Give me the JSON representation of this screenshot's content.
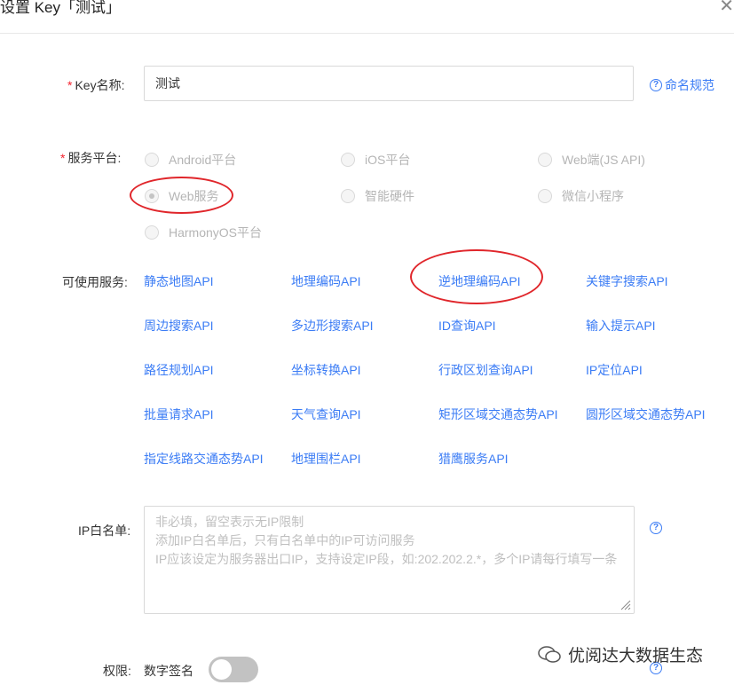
{
  "header": {
    "title": "设置 Key「测试」",
    "close_glyph": "✕"
  },
  "form": {
    "key_name": {
      "required_mark": "*",
      "label": "Key名称:",
      "value": "测试",
      "help_icon": "?",
      "help_text": "命名规范"
    },
    "platform": {
      "required_mark": "*",
      "label": "服务平台:",
      "options": [
        {
          "label": "Android平台",
          "checked": false
        },
        {
          "label": "iOS平台",
          "checked": false
        },
        {
          "label": "Web端(JS API)",
          "checked": false
        },
        {
          "label": "Web服务",
          "checked": true
        },
        {
          "label": "智能硬件",
          "checked": false
        },
        {
          "label": "微信小程序",
          "checked": false
        },
        {
          "label": "HarmonyOS平台",
          "checked": false
        }
      ]
    },
    "services": {
      "label": "可使用服务:",
      "items": [
        "静态地图API",
        "地理编码API",
        "逆地理编码API",
        "关键字搜索API",
        "周边搜索API",
        "多边形搜索API",
        "ID查询API",
        "输入提示API",
        "路径规划API",
        "坐标转换API",
        "行政区划查询API",
        "IP定位API",
        "批量请求API",
        "天气查询API",
        "矩形区域交通态势API",
        "圆形区域交通态势API",
        "指定线路交通态势API",
        "地理围栏API",
        "猎鹰服务API"
      ]
    },
    "ip_whitelist": {
      "label": "IP白名单:",
      "placeholder": "非必填，留空表示无IP限制\n添加IP白名单后，只有白名单中的IP可访问服务\nIP应该设定为服务器出口IP，支持设定IP段，如:202.202.2.*，多个IP请每行填写一条",
      "help_icon": "?"
    },
    "permission": {
      "label": "权限:",
      "option_label": "数字签名",
      "enabled": false,
      "help_icon": "?"
    }
  },
  "watermark": {
    "text": "优阅达大数据生态"
  },
  "colors": {
    "link": "#3b7cf5",
    "required": "#f5222d",
    "annotation": "#e0262b",
    "toggle_off": "#c2c2c2"
  }
}
